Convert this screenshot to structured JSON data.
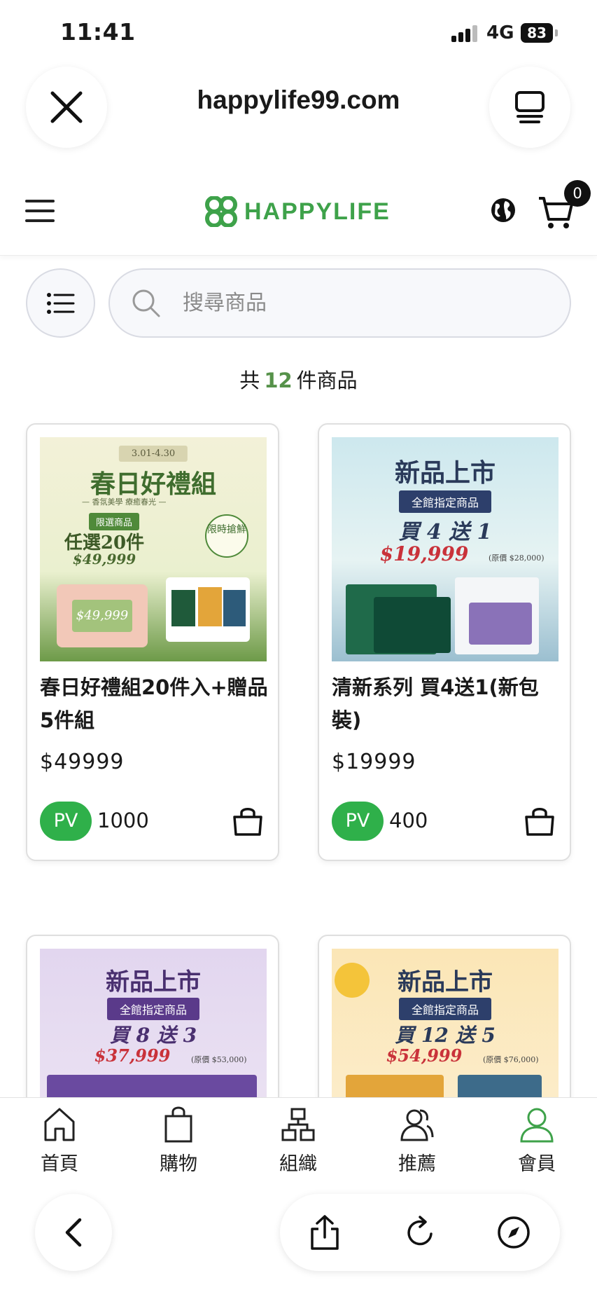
{
  "status_bar": {
    "time": "11:41",
    "network": "4G",
    "battery": "83"
  },
  "browser": {
    "url": "happylife99.com"
  },
  "header": {
    "logo_text": "HAPPYLIFE",
    "cart_count": "0"
  },
  "search": {
    "placeholder": "搜尋商品"
  },
  "count": {
    "prefix": "共",
    "number": "12",
    "suffix": "件商品"
  },
  "products": [
    {
      "name": "春日好禮組20件入+贈品5件組",
      "price": "$49999",
      "pv_label": "PV",
      "pv": "1000",
      "poster": {
        "dates": "3.01-4.30",
        "title": "春日好禮組",
        "subtitle": "— 香氛美學 療癒春光 —",
        "ribbon": "限選商品",
        "deal": "任選20件",
        "price": "$49,999",
        "tag": "限時搶鮮",
        "box_price": "$49,999"
      }
    },
    {
      "name": "清新系列 買4送1(新包裝)",
      "price": "$19999",
      "pv_label": "PV",
      "pv": "400",
      "poster": {
        "title": "新品上市",
        "ribbon": "全館指定商品",
        "deal": "買 4 送 1",
        "price": "$19,999",
        "note": "(原價 $28,000)"
      }
    },
    {
      "poster": {
        "title": "新品上市",
        "ribbon": "全館指定商品",
        "deal": "買 8 送 3",
        "price": "$37,999",
        "note": "(原價 $53,000)"
      }
    },
    {
      "poster": {
        "title": "新品上市",
        "ribbon": "全館指定商品",
        "deal": "買 12 送 5",
        "price": "$54,999",
        "note": "(原價 $76,000)"
      }
    }
  ],
  "bottom_nav": [
    {
      "label": "首頁",
      "icon": "home-icon"
    },
    {
      "label": "購物",
      "icon": "shopping-bag-icon"
    },
    {
      "label": "組織",
      "icon": "organization-icon"
    },
    {
      "label": "推薦",
      "icon": "referral-icon"
    },
    {
      "label": "會員",
      "icon": "member-icon",
      "active": true
    }
  ],
  "colors": {
    "brand_green": "#3ea24a",
    "pv_green": "#2fb04a",
    "count_green": "#56924a"
  }
}
